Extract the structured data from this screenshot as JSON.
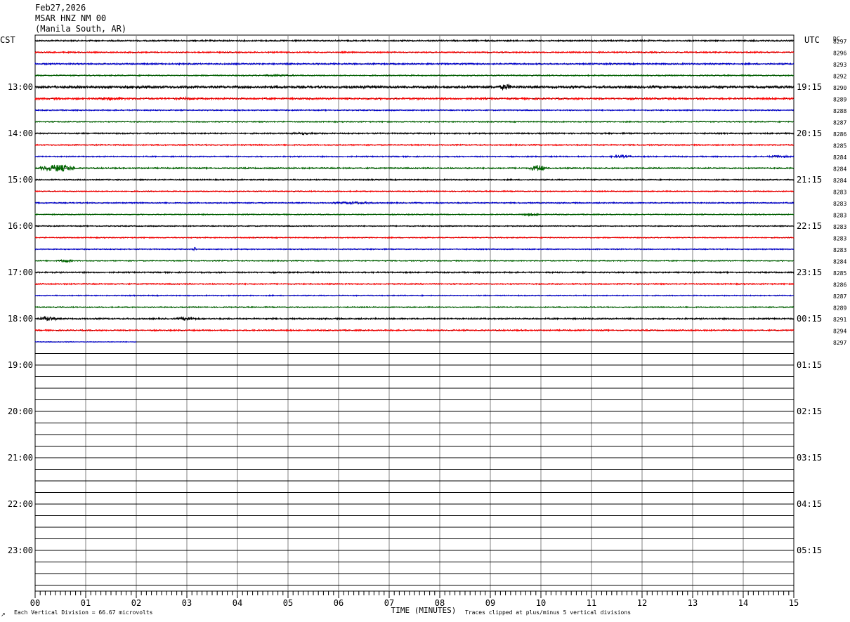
{
  "header": {
    "date": "Feb27,2026",
    "station": "MSAR HNZ NM 00",
    "location": "(Manila South, AR)"
  },
  "footer": {
    "division_note": "Each Vertical Division =   66.67 microvolts",
    "clip_note": "Traces clipped at plus/minus 5 vertical divisions",
    "corner_mark": "↗"
  },
  "colors": {
    "black": "#000000",
    "red": "#ff0000",
    "blue": "#0000cc",
    "green": "#006600",
    "grid": "#808080"
  },
  "chart_data": {
    "type": "line",
    "title": "",
    "xlabel": "TIME (MINUTES)",
    "left_axis_label": "CST",
    "right_axis_label": "UTC",
    "dc_label": "DC",
    "xlim": [
      0,
      15
    ],
    "x_ticks": [
      "00",
      "01",
      "02",
      "03",
      "04",
      "05",
      "06",
      "07",
      "08",
      "09",
      "10",
      "11",
      "12",
      "13",
      "14",
      "15"
    ],
    "left_hour_labels": [
      "13:00",
      "14:00",
      "15:00",
      "16:00",
      "17:00",
      "18:00",
      "19:00",
      "20:00",
      "21:00",
      "22:00",
      "23:00"
    ],
    "right_hour_labels": [
      "19:15",
      "20:15",
      "21:15",
      "22:15",
      "23:15",
      "00:15",
      "01:15",
      "02:15",
      "03:15",
      "04:15",
      "05:15"
    ],
    "rows_total": 48,
    "rows_per_hour": 4,
    "first_label_row": 4,
    "color_cycle": [
      "black",
      "red",
      "blue",
      "green"
    ],
    "dc_offsets": [
      8297,
      8296,
      8293,
      8292,
      8290,
      8289,
      8288,
      8287,
      8286,
      8285,
      8284,
      8284,
      8284,
      8283,
      8283,
      8283,
      8283,
      8283,
      8283,
      8284,
      8285,
      8286,
      8287,
      8289,
      8291,
      8294,
      8297
    ],
    "traces": [
      {
        "row": 0,
        "color": "black",
        "end_min": 15,
        "amp": 1.0
      },
      {
        "row": 1,
        "color": "red",
        "end_min": 15,
        "amp": 0.9
      },
      {
        "row": 2,
        "color": "blue",
        "end_min": 15,
        "amp": 1.0
      },
      {
        "row": 3,
        "color": "green",
        "end_min": 15,
        "amp": 0.8,
        "events": [
          {
            "t": 4.8,
            "w": 1.2,
            "a": 1.5
          }
        ]
      },
      {
        "row": 4,
        "color": "black",
        "end_min": 15,
        "amp": 1.6,
        "events": [
          {
            "t": 2.0,
            "w": 2.0,
            "a": 2.0
          },
          {
            "t": 6.5,
            "w": 2.5,
            "a": 2.0
          },
          {
            "t": 9.3,
            "w": 0.25,
            "a": 5.0
          },
          {
            "t": 13.5,
            "w": 1.5,
            "a": 2.0
          }
        ]
      },
      {
        "row": 5,
        "color": "red",
        "end_min": 15,
        "amp": 1.2,
        "events": [
          {
            "t": 1.5,
            "w": 1.0,
            "a": 2.2
          },
          {
            "t": 3.0,
            "w": 0.8,
            "a": 2.0
          }
        ]
      },
      {
        "row": 6,
        "color": "blue",
        "end_min": 15,
        "amp": 0.8
      },
      {
        "row": 7,
        "color": "green",
        "end_min": 15,
        "amp": 0.7
      },
      {
        "row": 8,
        "color": "black",
        "end_min": 15,
        "amp": 0.9,
        "events": [
          {
            "t": 5.3,
            "w": 1.0,
            "a": 1.6
          }
        ]
      },
      {
        "row": 9,
        "color": "red",
        "end_min": 15,
        "amp": 0.8
      },
      {
        "row": 10,
        "color": "blue",
        "end_min": 15,
        "amp": 0.8,
        "events": [
          {
            "t": 11.6,
            "w": 0.5,
            "a": 2.2
          },
          {
            "t": 14.7,
            "w": 0.5,
            "a": 2.0
          }
        ]
      },
      {
        "row": 11,
        "color": "green",
        "end_min": 15,
        "amp": 0.9,
        "events": [
          {
            "t": 0.45,
            "w": 0.7,
            "a": 5.5
          },
          {
            "t": 9.95,
            "w": 0.35,
            "a": 5.0
          }
        ]
      },
      {
        "row": 12,
        "color": "black",
        "end_min": 15,
        "amp": 0.8
      },
      {
        "row": 13,
        "color": "red",
        "end_min": 15,
        "amp": 0.7
      },
      {
        "row": 14,
        "color": "blue",
        "end_min": 15,
        "amp": 0.8,
        "events": [
          {
            "t": 6.3,
            "w": 1.0,
            "a": 2.0
          }
        ]
      },
      {
        "row": 15,
        "color": "green",
        "end_min": 15,
        "amp": 0.7,
        "events": [
          {
            "t": 9.8,
            "w": 0.4,
            "a": 2.2
          }
        ]
      },
      {
        "row": 16,
        "color": "black",
        "end_min": 15,
        "amp": 0.7
      },
      {
        "row": 17,
        "color": "red",
        "end_min": 15,
        "amp": 0.7
      },
      {
        "row": 18,
        "color": "blue",
        "end_min": 15,
        "amp": 0.7,
        "events": [
          {
            "t": 3.15,
            "w": 0.05,
            "a": 4.0
          }
        ]
      },
      {
        "row": 19,
        "color": "green",
        "end_min": 15,
        "amp": 0.7,
        "events": [
          {
            "t": 0.6,
            "w": 0.3,
            "a": 2.5
          }
        ]
      },
      {
        "row": 20,
        "color": "black",
        "end_min": 15,
        "amp": 0.9
      },
      {
        "row": 21,
        "color": "red",
        "end_min": 15,
        "amp": 0.8
      },
      {
        "row": 22,
        "color": "blue",
        "end_min": 15,
        "amp": 0.7
      },
      {
        "row": 23,
        "color": "green",
        "end_min": 15,
        "amp": 0.7
      },
      {
        "row": 24,
        "color": "black",
        "end_min": 15,
        "amp": 1.0,
        "events": [
          {
            "t": 0.25,
            "w": 0.4,
            "a": 3.5
          },
          {
            "t": 3.0,
            "w": 0.4,
            "a": 3.0
          }
        ]
      },
      {
        "row": 25,
        "color": "red",
        "end_min": 15,
        "amp": 0.9
      },
      {
        "row": 26,
        "color": "blue",
        "end_min": 2,
        "amp": 0.5
      }
    ]
  }
}
